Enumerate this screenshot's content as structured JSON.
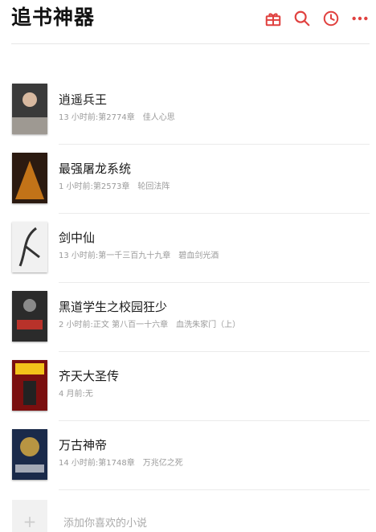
{
  "header": {
    "title": "追书神器",
    "accent_color": "#e0413f",
    "icons": [
      "gift-icon",
      "search-icon",
      "clock-icon",
      "more-icon"
    ]
  },
  "books": [
    {
      "title": "逍遥兵王",
      "updated": "13 小时前:第2774章",
      "latest": "佳人心思",
      "cover_colors": [
        "#3a3a3a",
        "#c9c2b8"
      ]
    },
    {
      "title": "最强屠龙系统",
      "updated": "1 小时前:第2573章",
      "latest": "轮回法阵",
      "cover_colors": [
        "#2b1a10",
        "#e88a1a"
      ]
    },
    {
      "title": "剑中仙",
      "updated": "13 小时前:第一千三百九十九章",
      "latest": "碧血剑光酒",
      "cover_colors": [
        "#f1f1f1",
        "#333333"
      ]
    },
    {
      "title": "黑道学生之校园狂少",
      "updated": "2 小时前:正文 第八百一十六章",
      "latest": "血洗朱家门（上）",
      "cover_colors": [
        "#2b2b2b",
        "#b8322a"
      ]
    },
    {
      "title": "齐天大圣传",
      "updated": "4 月前:无",
      "latest": "",
      "cover_colors": [
        "#7a0f0f",
        "#f2c21a"
      ]
    },
    {
      "title": "万古神帝",
      "updated": "14 小时前:第1748章",
      "latest": "万兆亿之死",
      "cover_colors": [
        "#1a2a4a",
        "#e0b040"
      ]
    }
  ],
  "add": {
    "label": "添加你喜欢的小说"
  }
}
